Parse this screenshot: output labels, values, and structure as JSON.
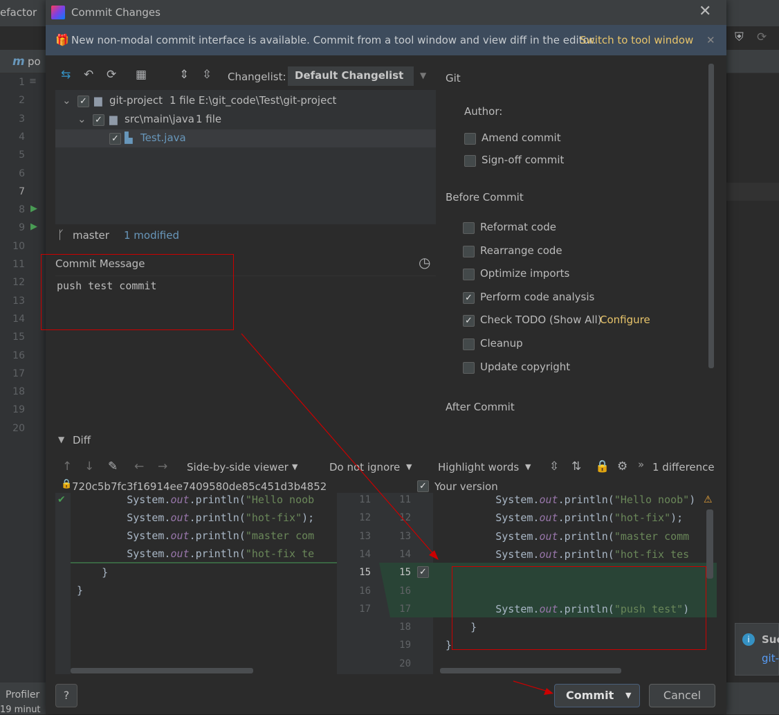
{
  "ide": {
    "top_left_text": "efactor",
    "tab_text": "po",
    "line_numbers": [
      "1",
      "2",
      "3",
      "4",
      "5",
      "6",
      "7",
      "8",
      "9",
      "10",
      "11",
      "12",
      "13",
      "14",
      "15",
      "16",
      "17",
      "18",
      "19",
      "20"
    ],
    "bottom_profiler": "Profiler",
    "bottom_time": "19 minut",
    "notification_title": "Suc",
    "notification_link": "git-"
  },
  "dialog": {
    "title": "Commit Changes",
    "banner_text": "New non-modal commit interface is available. Commit from a tool window and view diff in the editor.",
    "banner_link": "Switch to tool window",
    "changelist_label": "Changelist:",
    "changelist_value": "Default Changelist",
    "tree": [
      {
        "name": "git-project",
        "info": "1 file  E:\\git_code\\Test\\git-project"
      },
      {
        "name": "src\\main\\java",
        "info": "1 file"
      },
      {
        "name": "Test.java",
        "info": ""
      }
    ],
    "branch": "master",
    "modified": "1 modified",
    "commit_message_label": "Commit Message",
    "commit_message": "push test commit",
    "git_section": "Git",
    "author_label": "Author:",
    "git_options": [
      {
        "label": "Amend commit",
        "checked": false
      },
      {
        "label": "Sign-off commit",
        "checked": false
      }
    ],
    "before_commit_title": "Before Commit",
    "before_options": [
      {
        "label": "Reformat code",
        "checked": false
      },
      {
        "label": "Rearrange code",
        "checked": false
      },
      {
        "label": "Optimize imports",
        "checked": false
      },
      {
        "label": "Perform code analysis",
        "checked": true
      },
      {
        "label": "Check TODO (Show All)",
        "checked": true
      },
      {
        "label": "Cleanup",
        "checked": false
      },
      {
        "label": "Update copyright",
        "checked": false
      }
    ],
    "configure_link": "Configure",
    "after_commit_title": "After Commit",
    "diff_label": "Diff",
    "viewer_dropdown": "Side-by-side viewer",
    "ignore_dropdown": "Do not ignore",
    "highlight_dropdown": "Highlight words",
    "difference_count": "1 difference",
    "left_revision": "720c5b7fc3f16914ee7409580de85c451d3b4852",
    "right_revision": "Your version",
    "left_code": [
      {
        "num": "",
        "pre": "        System.",
        "fld": "out",
        "fn": ".println(",
        "str": "\"Hello noob",
        "post": ""
      },
      {
        "num": "",
        "pre": "        System.",
        "fld": "out",
        "fn": ".println(",
        "str": "\"hot-fix\"",
        "post": ");"
      },
      {
        "num": "",
        "pre": "        System.",
        "fld": "out",
        "fn": ".println(",
        "str": "\"master com",
        "post": ""
      },
      {
        "num": "",
        "pre": "        System.",
        "fld": "out",
        "fn": ".println(",
        "str": "\"hot-fix te",
        "post": ""
      },
      {
        "num": "",
        "pre": "    }",
        "fld": "",
        "fn": "",
        "str": "",
        "post": ""
      },
      {
        "num": "",
        "pre": "}",
        "fld": "",
        "fn": "",
        "str": "",
        "post": ""
      }
    ],
    "left_nums": [
      "11",
      "12",
      "13",
      "14",
      "15",
      "16",
      "17"
    ],
    "right_nums": [
      "11",
      "12",
      "13",
      "14",
      "15",
      "16",
      "17",
      "18",
      "19",
      "20"
    ],
    "right_code": [
      {
        "pre": "        System.",
        "fld": "out",
        "fn": ".println(",
        "str": "\"Hello noob\"",
        "post": ")"
      },
      {
        "pre": "        System.",
        "fld": "out",
        "fn": ".println(",
        "str": "\"hot-fix\"",
        "post": ");"
      },
      {
        "pre": "        System.",
        "fld": "out",
        "fn": ".println(",
        "str": "\"master comm",
        "post": ""
      },
      {
        "pre": "        System.",
        "fld": "out",
        "fn": ".println(",
        "str": "\"hot-fix tes",
        "post": ""
      },
      {
        "pre": "",
        "fld": "",
        "fn": "",
        "str": "",
        "post": ""
      },
      {
        "pre": "",
        "fld": "",
        "fn": "",
        "str": "",
        "post": ""
      },
      {
        "pre": "        System.",
        "fld": "out",
        "fn": ".println(",
        "str": "\"push test\"",
        "post": ")"
      },
      {
        "pre": "    }",
        "fld": "",
        "fn": "",
        "str": "",
        "post": ""
      },
      {
        "pre": "}",
        "fld": "",
        "fn": "",
        "str": "",
        "post": ""
      }
    ],
    "help_label": "?",
    "commit_button": "Commit",
    "cancel_button": "Cancel"
  },
  "colors": {
    "dialog_bg": "#2b2b2b",
    "banner_bg": "#3d4b5c",
    "link": "#e8c46a",
    "modified": "#6897bb",
    "added_bg": "#294436",
    "annotation": "#cc0000"
  }
}
